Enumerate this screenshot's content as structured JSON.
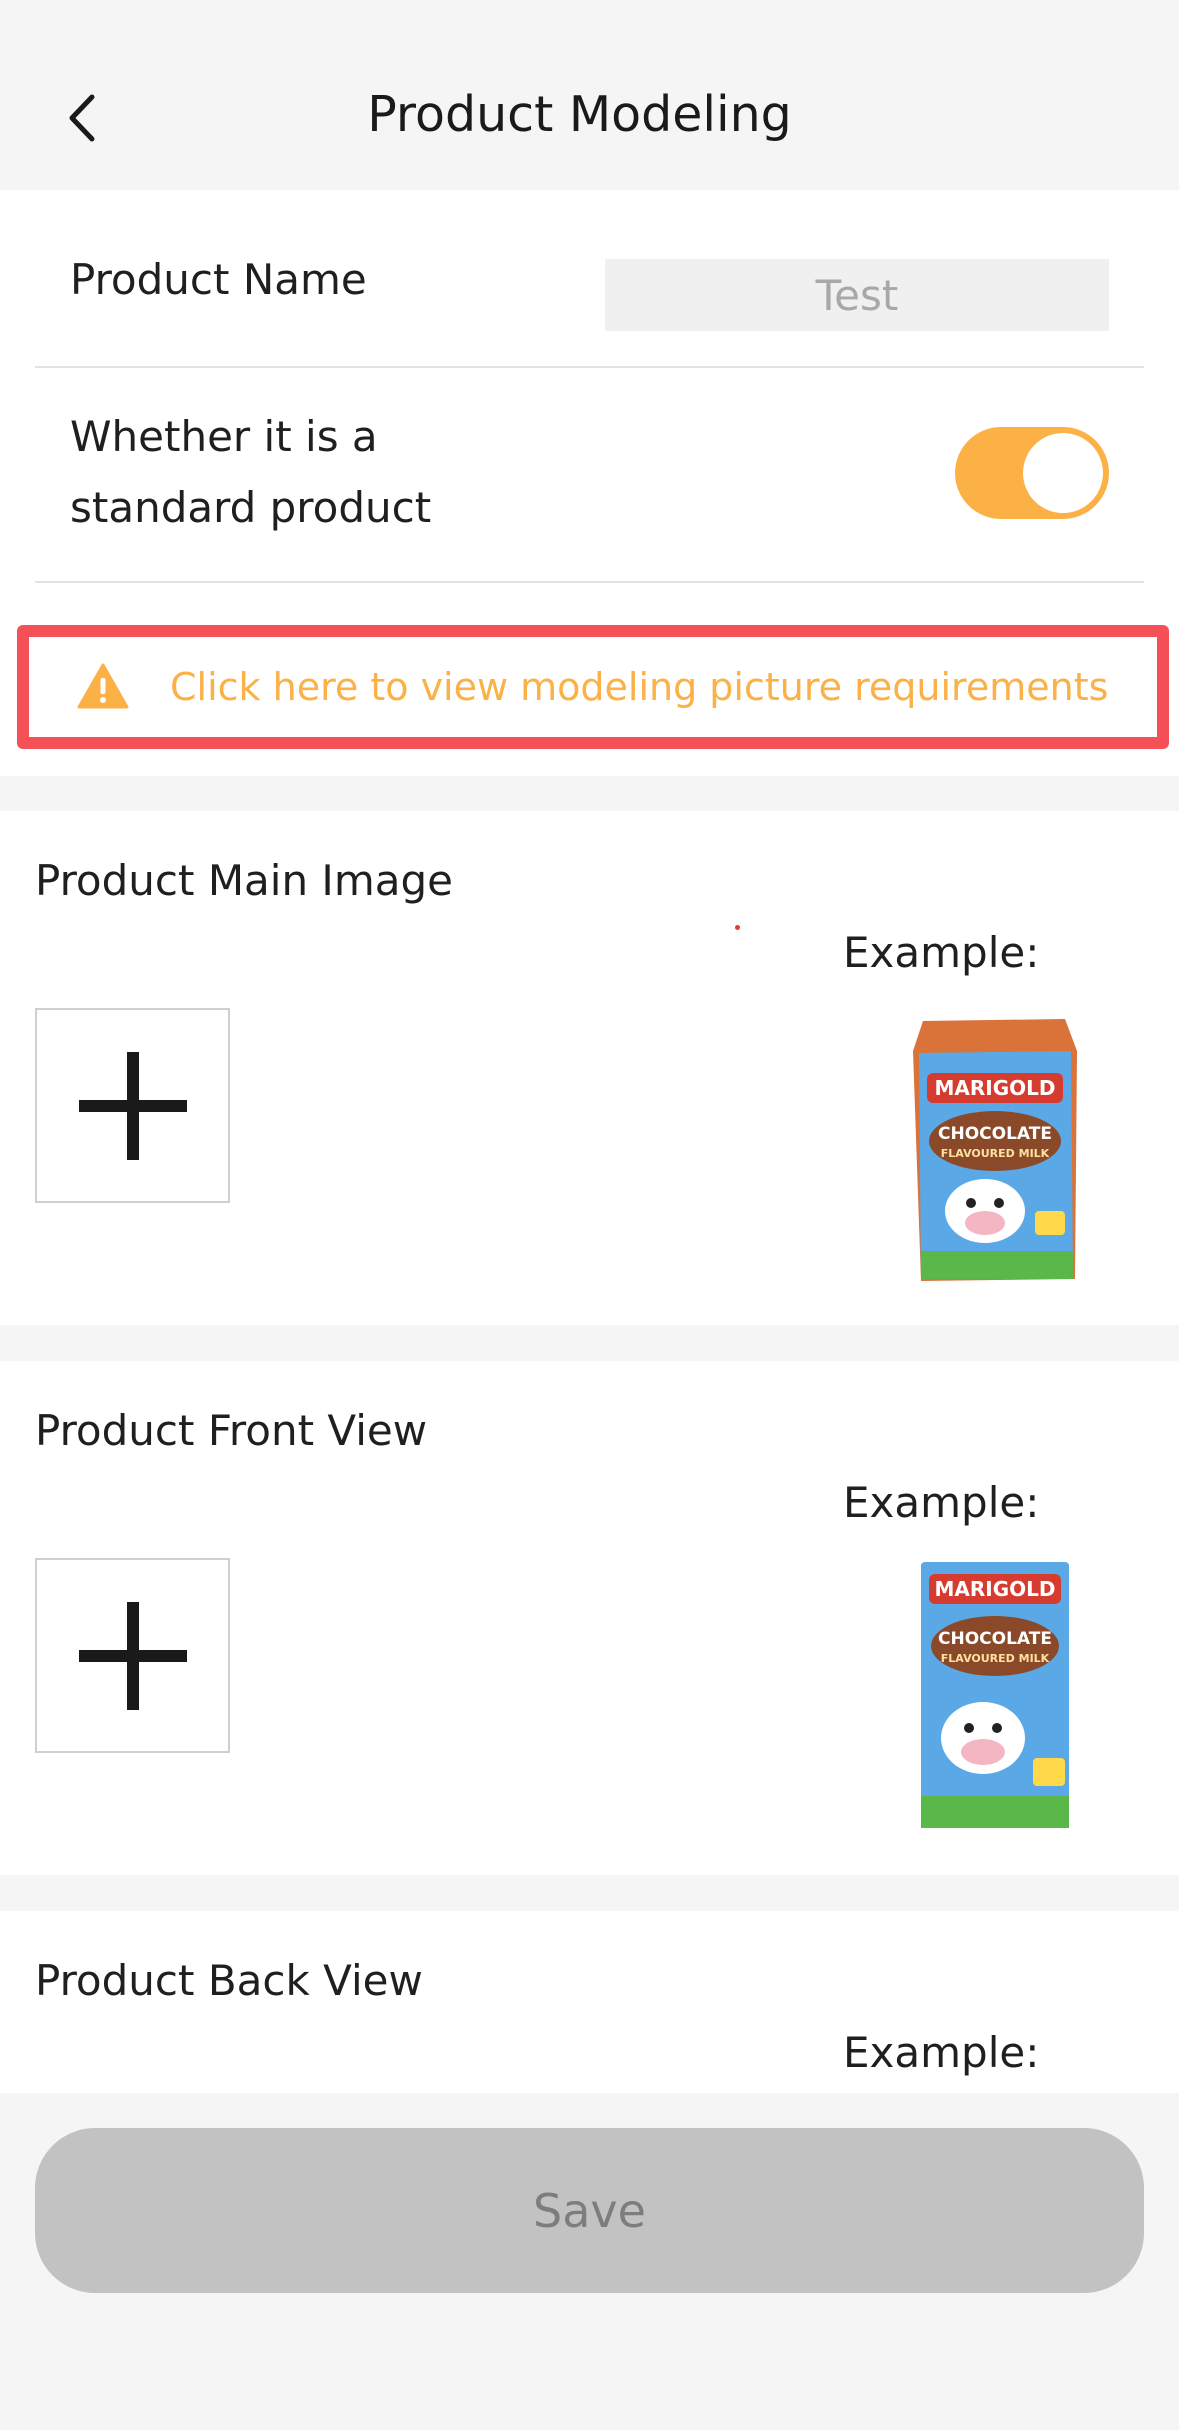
{
  "header": {
    "title": "Product Modeling",
    "back_icon": "chevron-left-icon"
  },
  "form": {
    "product_name_label": "Product Name",
    "product_name_value": "Test",
    "standard_label_line1": "Whether it is a",
    "standard_label_line2": "standard product",
    "standard_toggle_on": true,
    "requirements_link": "Click here to view modeling picture requirements",
    "requirements_icon": "warning-icon"
  },
  "sections": [
    {
      "title": "Product Main Image",
      "example_label": "Example:",
      "upload_icon": "plus-icon"
    },
    {
      "title": "Product Front View",
      "example_label": "Example:",
      "upload_icon": "plus-icon"
    },
    {
      "title": "Product Back View",
      "example_label": "Example:"
    }
  ],
  "example_product": {
    "brand": "MARIGOLD",
    "name_line1": "CHOCOLATE",
    "name_line2": "FLAVOURED MILK"
  },
  "footer": {
    "save_label": "Save"
  },
  "colors": {
    "accent": "#fbb146",
    "highlight_border": "#f55058",
    "disabled_button": "#c2c2c2"
  }
}
